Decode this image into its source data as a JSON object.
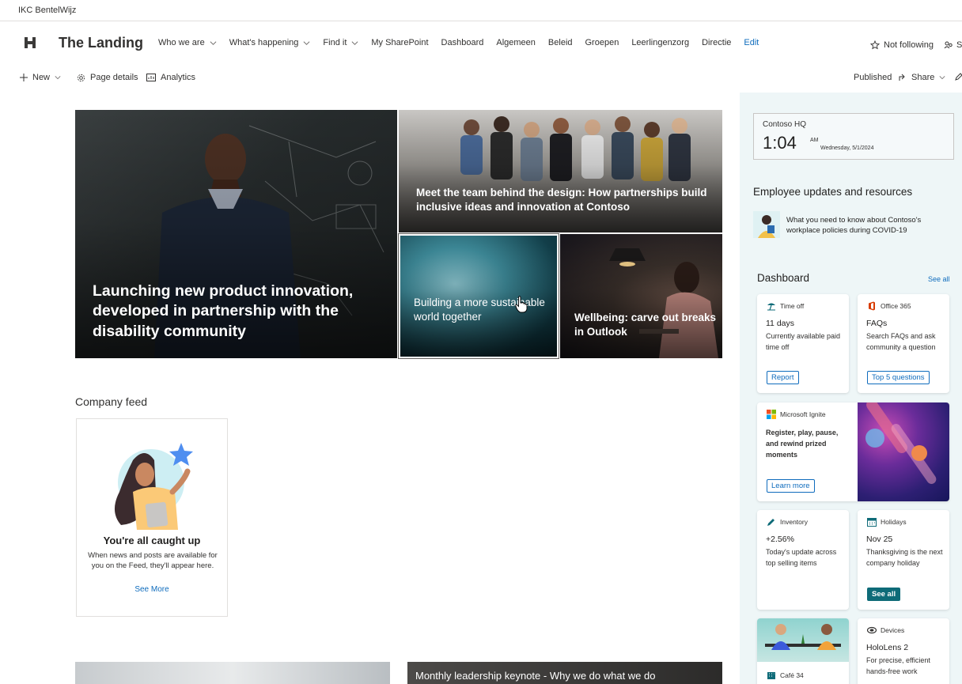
{
  "suite": {
    "org_name": "IKC BentelWijz"
  },
  "site": {
    "title": "The Landing",
    "nav": [
      {
        "label": "Who we are",
        "dropdown": true
      },
      {
        "label": "What's happening",
        "dropdown": true
      },
      {
        "label": "Find it",
        "dropdown": true
      },
      {
        "label": "My SharePoint",
        "dropdown": false
      },
      {
        "label": "Dashboard",
        "dropdown": false
      },
      {
        "label": "Algemeen",
        "dropdown": false
      },
      {
        "label": "Beleid",
        "dropdown": false
      },
      {
        "label": "Groepen",
        "dropdown": false
      },
      {
        "label": "Leerlingenzorg",
        "dropdown": false
      },
      {
        "label": "Directie",
        "dropdown": false
      },
      {
        "label": "Edit",
        "dropdown": false
      }
    ],
    "follow_label": "Not following",
    "share_label": "S"
  },
  "commands": {
    "new_label": "New",
    "page_details_label": "Page details",
    "analytics_label": "Analytics",
    "published_label": "Published",
    "share_label": "Share"
  },
  "hero": {
    "tile1": "Launching new product innovation, developed in partnership with the disability community",
    "tile2": "Meet the team behind the design: How partnerships build inclusive ideas and innovation at Contoso",
    "tile3": "Building a more sustainable world together",
    "tile4": "Wellbeing: carve out breaks in Outlook"
  },
  "feed": {
    "title": "Company feed",
    "heading": "You're all caught up",
    "text": "When news and posts are available for you on the Feed, they'll appear here.",
    "link": "See More"
  },
  "bottom": {
    "tile2": "Monthly leadership keynote - Why we do what we do"
  },
  "rail": {
    "clock": {
      "location": "Contoso HQ",
      "time": "1:04",
      "ampm": "AM",
      "date": "Wednesday, 5/1/2024"
    },
    "employee_heading": "Employee updates and resources",
    "employee_item": "What you need to know about Contoso's workplace policies during COVID-19",
    "dashboard_heading": "Dashboard",
    "dashboard_see_all": "See all",
    "cards": {
      "timeoff": {
        "app": "Time off",
        "title": "11 days",
        "desc": "Currently available paid time off",
        "button": "Report"
      },
      "office": {
        "app": "Office 365",
        "title": "FAQs",
        "desc": "Search FAQs and ask community a question",
        "button": "Top 5 questions"
      },
      "ignite": {
        "app": "Microsoft Ignite",
        "desc": "Register, play, pause, and rewind prized moments",
        "button": "Learn more"
      },
      "inventory": {
        "app": "Inventory",
        "title": "+2.56%",
        "desc": "Today's update across top selling items"
      },
      "holidays": {
        "app": "Holidays",
        "title": "Nov 25",
        "desc": "Thanksgiving is the next company holiday",
        "button": "See all"
      },
      "cafe": {
        "app": "Café 34"
      },
      "devices": {
        "app": "Devices",
        "title": "HoloLens 2",
        "desc": "For precise, efficient hands-free work"
      }
    }
  }
}
